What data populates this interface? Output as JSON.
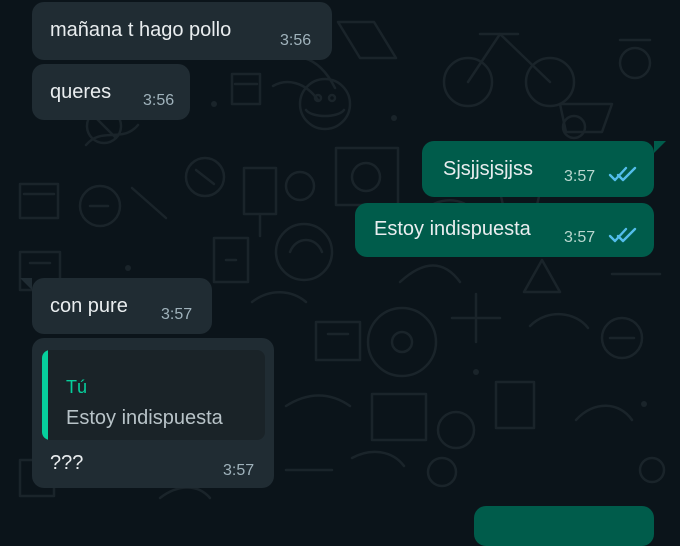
{
  "messages": [
    {
      "direction": "incoming",
      "text": "mañana t hago pollo",
      "time": "3:56"
    },
    {
      "direction": "incoming",
      "text": "queres",
      "time": "3:56"
    },
    {
      "direction": "outgoing",
      "text": "Sjsjjsjsjjss",
      "time": "3:57",
      "status": "read"
    },
    {
      "direction": "outgoing",
      "text": "Estoy indispuesta",
      "time": "3:57",
      "status": "read"
    },
    {
      "direction": "incoming",
      "text": "con pure",
      "time": "3:57"
    },
    {
      "direction": "incoming",
      "reply_to": {
        "author": "Tú",
        "text": "Estoy indispuesta"
      },
      "text": "???",
      "time": "3:57"
    }
  ],
  "theme": {
    "background": "#0b141a",
    "incoming_bubble": "#202c33",
    "outgoing_bubble": "#005c4b",
    "read_ticks": "#53bdeb",
    "quote_accent": "#06cf9c"
  },
  "icons": {
    "read_receipt": "double-check-icon"
  }
}
